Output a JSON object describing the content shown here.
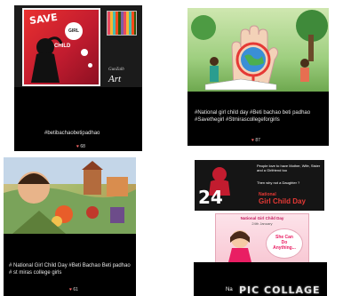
{
  "posts": [
    {
      "id": "post1",
      "art_text_save": "SAVE",
      "art_text_girl": "GIRL",
      "art_text_child": "CHILD",
      "art_signature": "GunZalb",
      "art_label": "Art",
      "caption": "#betibachaobetipadhao",
      "likes": "68"
    },
    {
      "id": "post2",
      "caption": "#National girl child day         #Beti bachao beti padhao     #Savethegirl #Stmirascollegeforgirls",
      "likes": "87"
    },
    {
      "id": "post3",
      "caption": "# National Girl Child Day                    #Beti Bachao Beti padhao           # st miras college girls",
      "likes": "61"
    },
    {
      "id": "post4",
      "poster_top": "People love to have Mother, Wife, Sister and a Girlfriend too",
      "poster_mid": "Then why not a Daughter ?",
      "poster_number": "24",
      "poster_title_1": "National",
      "poster_title_2": "Girl Child Day",
      "card_title": "National Girl Child Day",
      "card_date": "24th January",
      "card_bubble": "She Can Do Anything...",
      "bottom_text": "Na",
      "watermark": "PIC COLLAGE"
    }
  ]
}
